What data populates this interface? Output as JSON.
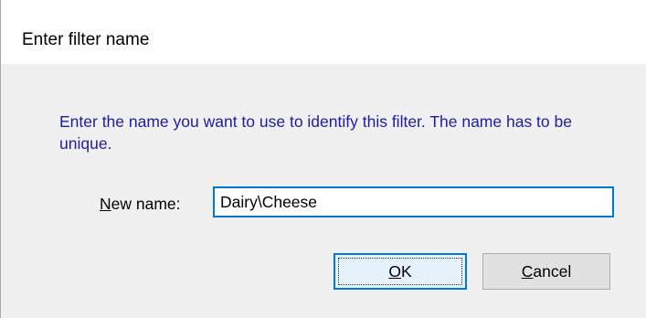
{
  "dialog": {
    "title": "Enter filter name",
    "instructions": "Enter the name you want to use to identify this filter. The name has to be unique.",
    "name_label_mnemonic": "N",
    "name_label_rest": "ew name:",
    "name_value": "Dairy\\Cheese",
    "ok_mnemonic": "O",
    "ok_rest": "K",
    "cancel_mnemonic": "C",
    "cancel_rest": "ancel"
  }
}
